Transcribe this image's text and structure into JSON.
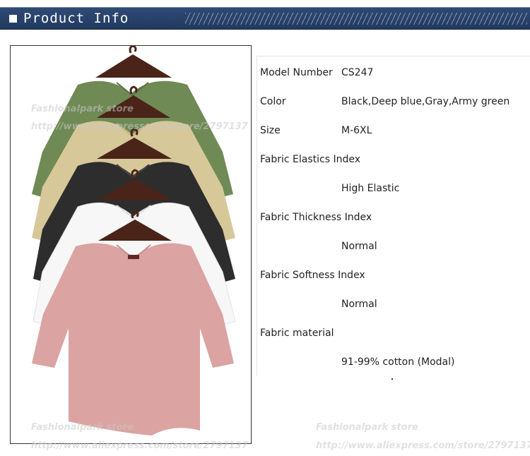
{
  "header": {
    "title": "Product Info"
  },
  "watermarks": {
    "store": "Fashionalpark store",
    "url": "http://www.aliexpress.com/store/2797137"
  },
  "specs": [
    {
      "label": "Model Number",
      "value": "CS247"
    },
    {
      "label": "Color",
      "value": "Black,Deep blue,Gray,Army green"
    },
    {
      "label": "Size",
      "value": "M-6XL"
    },
    {
      "label": "Fabric Elastics Index",
      "value": "High Elastic"
    },
    {
      "label": "Fabric Thickness Index",
      "value": "Normal"
    },
    {
      "label": "Fabric Softness Index",
      "value": "Normal"
    },
    {
      "label": "Fabric material",
      "value": "91-99% cotton (Modal)"
    }
  ],
  "colors": {
    "banner": "#2a4269",
    "army_green": "#6f8a55",
    "khaki": "#d7c89a",
    "black": "#2d2d2d",
    "white": "#f7f7f7",
    "pink": "#dca3a3",
    "hanger": "#4a2418"
  }
}
